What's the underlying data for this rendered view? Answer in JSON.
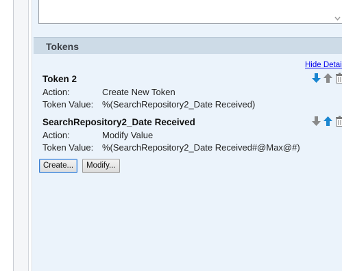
{
  "tokens_section": {
    "title": "Tokens",
    "hide_details_label": "Hide Details"
  },
  "tokens": [
    {
      "name": "Token 2",
      "action_label": "Action:",
      "action_value": "Create New Token",
      "token_value_label": "Token Value:",
      "token_value": "%(SearchRepository2_Date Received)"
    },
    {
      "name": "SearchRepository2_Date Received",
      "action_label": "Action:",
      "action_value": "Modify Value",
      "token_value_label": "Token Value:",
      "token_value": "%(SearchRepository2_Date Received#@Max@#)"
    }
  ],
  "buttons": {
    "create_label": "Create...",
    "modify_label": "Modify..."
  },
  "icons": {
    "move_down": "arrow-down-icon",
    "move_up": "arrow-up-icon",
    "delete": "trash-icon"
  },
  "colors": {
    "panel_bg": "#ebf3fb",
    "header_bg": "#cddbe7",
    "arrow_active": "#1a86d0",
    "arrow_disabled": "#8a8a8a",
    "link": "#0000ee"
  }
}
